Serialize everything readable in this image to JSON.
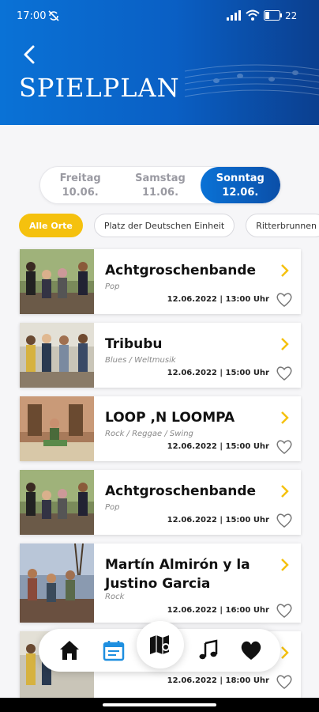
{
  "status": {
    "time": "17:00",
    "battery_pct": "22"
  },
  "header": {
    "title": "SPIELPLAN"
  },
  "days": [
    {
      "name": "Freitag",
      "date": "10.06."
    },
    {
      "name": "Samstag",
      "date": "11.06."
    },
    {
      "name": "Sonntag",
      "date": "12.06.",
      "active": true
    }
  ],
  "chips": [
    "Alle Orte",
    "Platz der Deutschen Einheit",
    "Ritterbrunnen"
  ],
  "events": [
    {
      "title": "Achtgroschenbande",
      "genre": "Pop",
      "date": "12.06.2022 | 13:00 Uhr"
    },
    {
      "title": "Tribubu",
      "genre": "Blues / Weltmusik",
      "date": "12.06.2022 | 15:00 Uhr"
    },
    {
      "title": "LOOP ,N LOOMPA",
      "genre": "Rock / Reggae / Swing",
      "date": "12.06.2022 | 15:00 Uhr"
    },
    {
      "title": "Achtgroschenbande",
      "genre": "Pop",
      "date": "12.06.2022 | 15:00 Uhr"
    },
    {
      "title": "Martín Almirón y la Justino Garcia",
      "genre": "Rock",
      "date": "12.06.2022 | 16:00 Uhr"
    },
    {
      "title": "",
      "genre": "",
      "date": "12.06.2022 | 18:00 Uhr"
    }
  ],
  "colors": {
    "primary": "#0a5fc4",
    "accent": "#f5c10e"
  },
  "nav": [
    "home-icon",
    "calendar-icon",
    "map-icon",
    "music-icon",
    "heart-icon"
  ]
}
